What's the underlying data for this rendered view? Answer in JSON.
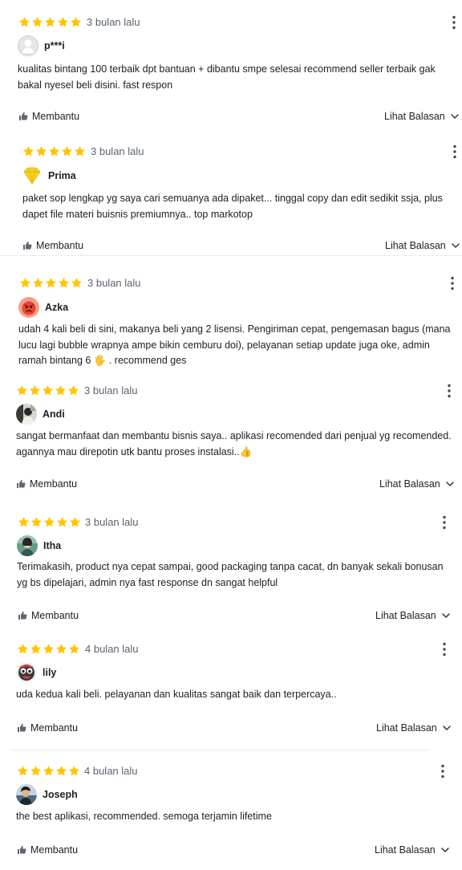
{
  "colors": {
    "star": "#FFC400",
    "meta_text": "#5a6470",
    "text": "#212121",
    "divider": "#ececec"
  },
  "icons": {
    "star": "star-icon",
    "menu": "more-vertical-icon",
    "helpful": "thumbs-up-icon",
    "reply": "chevron-down-icon"
  },
  "reviews": [
    {
      "rating": 5,
      "time": "3 bulan lalu",
      "user": "p***i",
      "avatar": "default-avatar-icon",
      "text": "kualitas bintang 100 terbaik dpt bantuan + dibantu smpe selesai recommend seller terbaik gak bakal nyesel beli disini. fast respon",
      "helpful_label": "Membantu",
      "reply_label": "Lihat Balasan"
    },
    {
      "rating": 5,
      "time": "3 bulan lalu",
      "user": "Prima",
      "avatar": "gold-diamond-avatar",
      "text": "paket sop lengkap yg saya cari semuanya ada dipaket... tinggal copy dan edit sedikit ssja, plus dapet file materi buisnis premiumnya.. top markotop",
      "helpful_label": "Membantu",
      "reply_label": "Lihat Balasan"
    },
    {
      "rating": 5,
      "time": "3 bulan lalu",
      "user": "Azka",
      "avatar": "angry-face-avatar",
      "text": "udah 4 kali beli di sini, makanya beli yang 2 lisensi. Pengiriman cepat, pengemasan bagus (mana lucu lagi bubble wrapnya ampe bikin cemburu doi), pelayanan setiap update juga oke, admin ramah bintang 6 🖐 . recommend ges"
    },
    {
      "rating": 5,
      "time": "3 bulan lalu",
      "user": "Andi",
      "avatar": "photo-avatar",
      "text": "sangat bermanfaat dan membantu bisnis saya.. aplikasi recomended dari penjual yg recomended. agannya mau direpotin utk bantu proses instalasi..👍",
      "helpful_label": "Membantu",
      "reply_label": "Lihat Balasan"
    },
    {
      "rating": 5,
      "time": "3 bulan lalu",
      "user": "Itha",
      "avatar": "photo-avatar",
      "text": "Terimakasih, product nya cepat sampai, good packaging tanpa cacat, dn banyak sekali bonusan yg bs dipelajari, admin nya fast response dn sangat helpful",
      "helpful_label": "Membantu",
      "reply_label": "Lihat Balasan"
    },
    {
      "rating": 5,
      "time": "4 bulan lalu",
      "user": "lily",
      "avatar": "cartoon-face-avatar",
      "text": "uda kedua kali beli. pelayanan dan kualitas sangat baik dan terpercaya..",
      "helpful_label": "Membantu",
      "reply_label": "Lihat Balasan"
    },
    {
      "rating": 5,
      "time": "4 bulan lalu",
      "user": "Joseph",
      "avatar": "photo-avatar",
      "text": "the best aplikasi, recommended. semoga terjamin lifetime",
      "helpful_label": "Membantu",
      "reply_label": "Lihat Balasan"
    }
  ]
}
